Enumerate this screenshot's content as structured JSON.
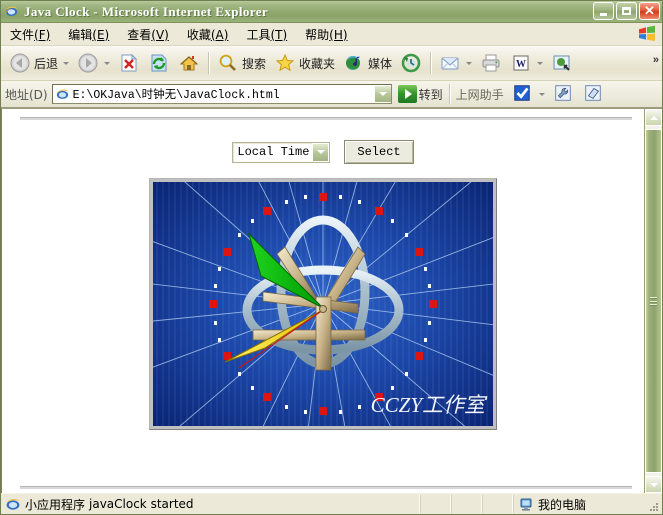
{
  "window": {
    "title": "Java Clock - Microsoft Internet Explorer",
    "icon": "ie-icon",
    "buttons": {
      "minimize": "minimize-button",
      "maximize": "maximize-button",
      "close": "close-button",
      "close_glyph": "✕"
    }
  },
  "menu": {
    "items": [
      {
        "label": "文件",
        "acc": "(F)"
      },
      {
        "label": "编辑",
        "acc": "(E)"
      },
      {
        "label": "查看",
        "acc": "(V)"
      },
      {
        "label": "收藏",
        "acc": "(A)"
      },
      {
        "label": "工具",
        "acc": "(T)"
      },
      {
        "label": "帮助",
        "acc": "(H)"
      }
    ],
    "brand_icon": "windows-flag-icon"
  },
  "toolbar": {
    "back_label": "后退",
    "forward_label": "",
    "stop_label": "",
    "refresh_label": "",
    "home_label": "",
    "search_label": "搜索",
    "favorites_label": "收藏夹",
    "media_label": "媒体",
    "history_label": "",
    "mail_label": "",
    "print_label": "",
    "edit_label": "",
    "messenger_label": "",
    "overflow_label": "»"
  },
  "address": {
    "label": "地址(D)",
    "value": "E:\\OKJava\\时钟无\\JavaClock.html",
    "placeholder": "",
    "go_label": "转到",
    "helper_label": "上网助手"
  },
  "page": {
    "timezone_select": {
      "value": "Local Time",
      "options": [
        "Local Time"
      ]
    },
    "select_button": "Select",
    "applet": {
      "watermark": "CCZY工作室",
      "background_color": "#13399c",
      "hour_marker_color": "#d81010",
      "minute_marker_color": "#ffffff",
      "minute_hand_color": "#00c800",
      "hour_hand_color": "#ffe000",
      "second_hand_color": "#e01010",
      "ring_color": "#aebfcc",
      "tube_color": "#c8b78a",
      "hour_angle_deg": 238,
      "minute_angle_deg": 306,
      "second_angle_deg": 218
    }
  },
  "scrollbar": {
    "up_arrow": "scroll-up-arrow",
    "down_arrow": "scroll-down-arrow",
    "thumb": "scroll-thumb"
  },
  "statusbar": {
    "icon": "ie-icon",
    "applet_label": "小应用程序",
    "applet_status": "javaClock started",
    "zone_label": "我的电脑",
    "zone_icon": "my-computer-icon"
  }
}
